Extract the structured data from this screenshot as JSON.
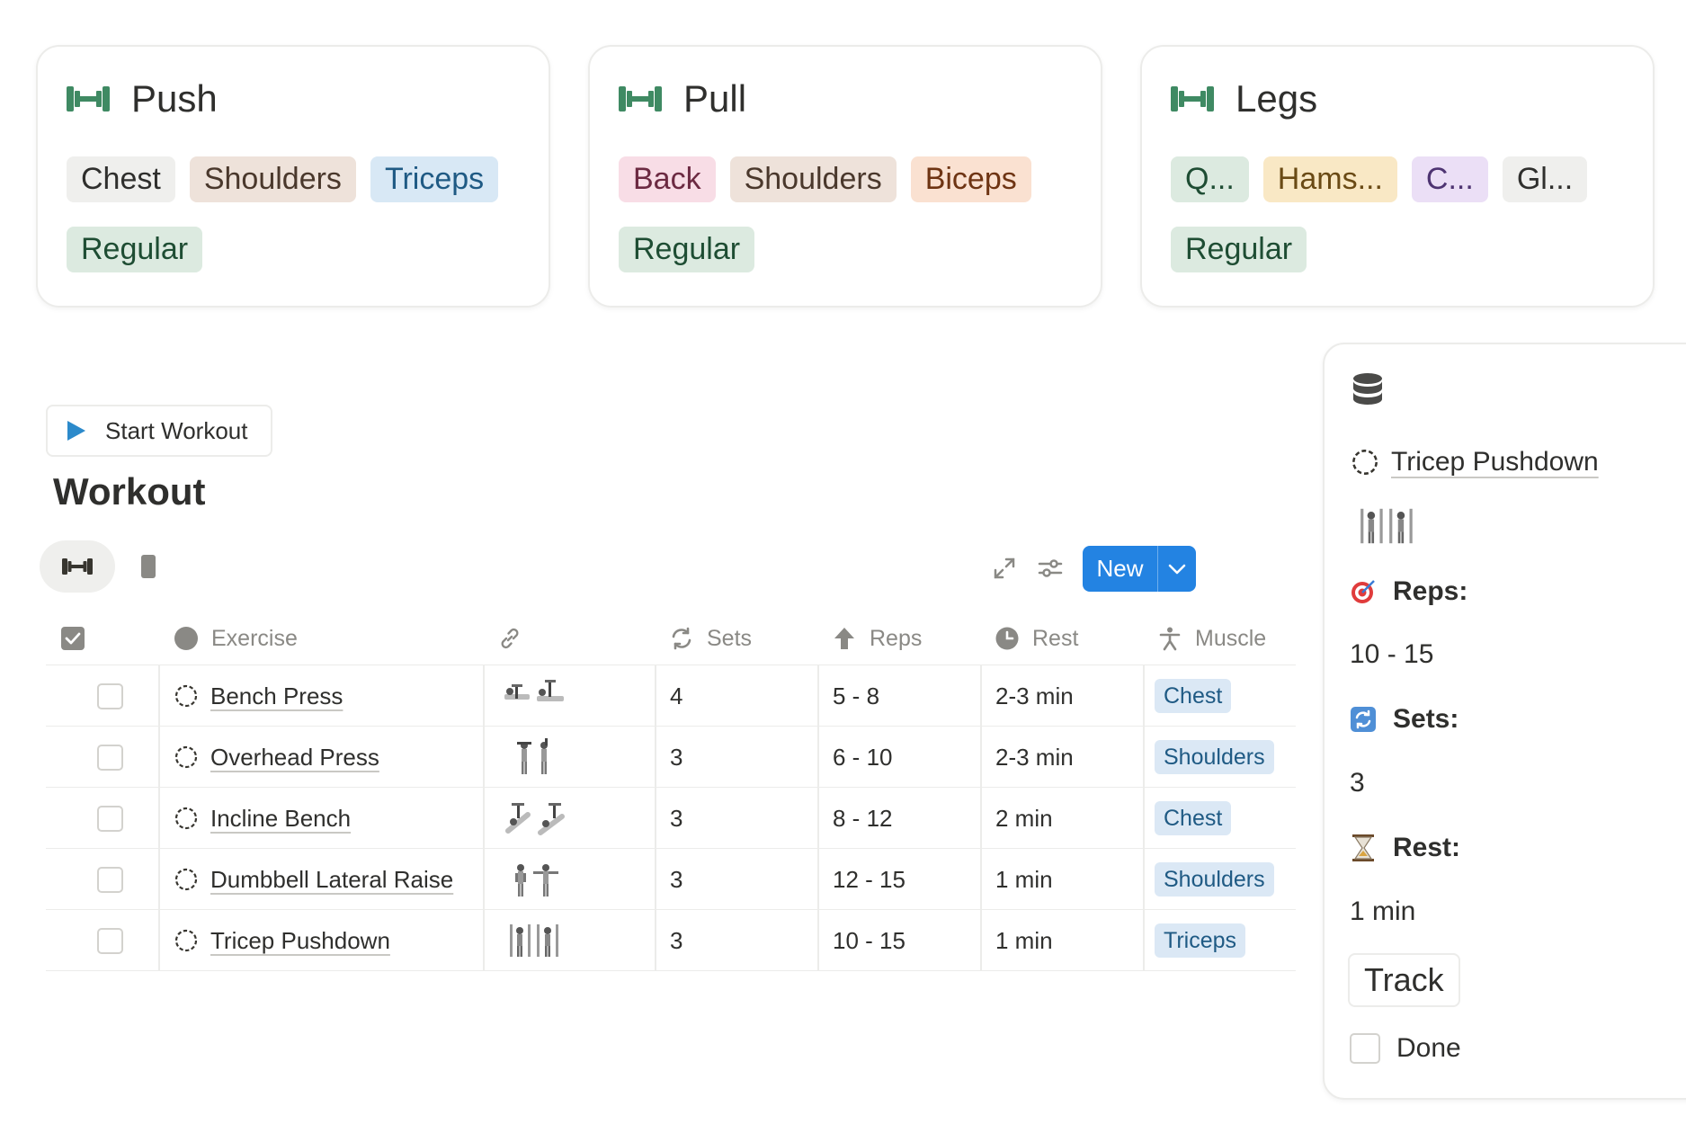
{
  "cards": [
    {
      "title": "Push",
      "tags_row1": [
        {
          "label": "Chest",
          "color": "gray"
        },
        {
          "label": "Shoulders",
          "color": "brown"
        },
        {
          "label": "Triceps",
          "color": "blue"
        }
      ],
      "tags_row2": [
        {
          "label": "Regular",
          "color": "green"
        }
      ]
    },
    {
      "title": "Pull",
      "tags_row1": [
        {
          "label": "Back",
          "color": "pink"
        },
        {
          "label": "Shoulders",
          "color": "brown"
        },
        {
          "label": "Biceps",
          "color": "orange"
        }
      ],
      "tags_row2": [
        {
          "label": "Regular",
          "color": "green"
        }
      ]
    },
    {
      "title": "Legs",
      "tags_row1": [
        {
          "label": "Q...",
          "color": "green"
        },
        {
          "label": "Hams...",
          "color": "yellow"
        },
        {
          "label": "C...",
          "color": "purple"
        },
        {
          "label": "Gl...",
          "color": "gray"
        }
      ],
      "tags_row2": [
        {
          "label": "Regular",
          "color": "green"
        }
      ]
    }
  ],
  "start_button": {
    "label": "Start Workout",
    "icon": "play-icon"
  },
  "workout": {
    "title": "Workout"
  },
  "toolbar": {
    "new_label": "New",
    "icons": [
      "expand-icon",
      "filter-settings-icon"
    ]
  },
  "views": [
    {
      "icon": "dumbbell-icon",
      "active": true
    },
    {
      "icon": "phone-icon",
      "active": false
    }
  ],
  "table": {
    "headers": {
      "exercise": "Exercise",
      "sets": "Sets",
      "reps": "Reps",
      "rest": "Rest",
      "muscle": "Muscle"
    },
    "rows": [
      {
        "exercise": "Bench Press",
        "sets": "4",
        "reps": "5 - 8",
        "rest": "2-3 min",
        "muscle": "Chest"
      },
      {
        "exercise": "Overhead Press",
        "sets": "3",
        "reps": "6 - 10",
        "rest": "2-3 min",
        "muscle": "Shoulders"
      },
      {
        "exercise": "Incline Bench",
        "sets": "3",
        "reps": "8 - 12",
        "rest": "2 min",
        "muscle": "Chest"
      },
      {
        "exercise": "Dumbbell Lateral Raise",
        "sets": "3",
        "reps": "12 - 15",
        "rest": "1 min",
        "muscle": "Shoulders"
      },
      {
        "exercise": "Tricep Pushdown",
        "sets": "3",
        "reps": "10 - 15",
        "rest": "1 min",
        "muscle": "Triceps"
      }
    ]
  },
  "panel": {
    "title": "Tricep Pushdown",
    "reps_label": "Reps:",
    "reps_value": "10 - 15",
    "sets_label": "Sets:",
    "sets_value": "3",
    "rest_label": "Rest:",
    "rest_value": "1 min",
    "track_label": "Track",
    "done_label": "Done"
  },
  "colors": {
    "accent": "#2383e2",
    "dumbbell": "#3f8a63",
    "play": "#2c8acb"
  }
}
